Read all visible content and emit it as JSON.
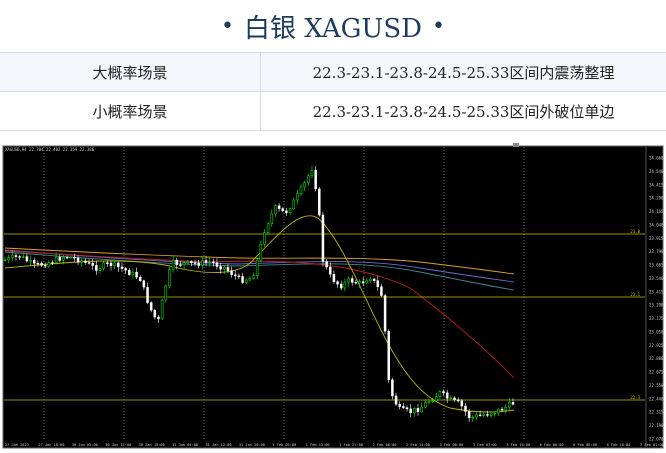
{
  "title": {
    "left_dot": "•",
    "text": "白银 XAGUSD",
    "right_dot": "•"
  },
  "scenarios": [
    {
      "label": "大概率场景",
      "value": "22.3-23.1-23.8-24.5-25.33区间内震荡整理"
    },
    {
      "label": "小概率场景",
      "value": "22.3-23.1-23.8-24.5-25.33区间外破位单边"
    }
  ],
  "chart": {
    "symbol_header": "XAGUSD,H4  22.384 22.402 22.359 22.386",
    "price_ticks": [
      "24.660",
      "24.540",
      "24.415",
      "24.290",
      "24.165",
      "24.040",
      "23.915",
      "23.790",
      "23.665",
      "23.540",
      "23.415",
      "23.290",
      "23.175",
      "23.050",
      "22.925",
      "22.800",
      "22.675",
      "22.550",
      "22.440",
      "22.315",
      "22.190",
      "22.070"
    ],
    "time_ticks": [
      "27 Jan 2023",
      "27 Jan 18:00",
      "30 Jan 03:00",
      "30 Jan 11:00",
      "30 Jan 19:00",
      "31 Jan 04:00",
      "31 Jan 12:00",
      "31 Jan 20:00",
      "1 Feb 05:00",
      "1 Feb 13:00",
      "1 Feb 21:00",
      "2 Feb 06:00",
      "2 Feb 14:00",
      "3 Feb 00:00",
      "3 Feb 07:00",
      "3 Feb 16:00",
      "6 Feb 00:00",
      "6 Feb 08:00",
      "6 Feb 16:00",
      "7 Feb 01:00"
    ],
    "level_labels": [
      "23.8",
      "23.1",
      "22.3"
    ],
    "colors": {
      "bg": "#000000",
      "bull": "#00ff00",
      "bear": "#ffffff",
      "level": "#c8c800",
      "grid": "#ffffff"
    }
  }
}
